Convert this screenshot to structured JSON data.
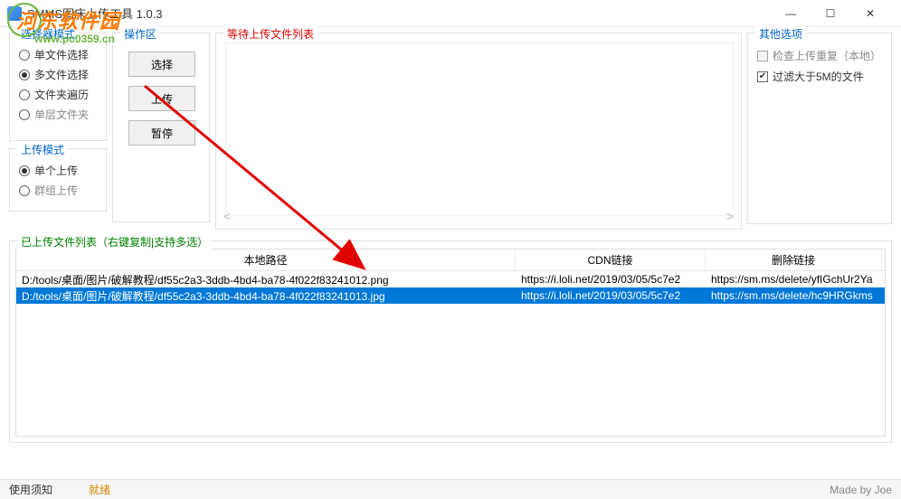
{
  "window": {
    "title": "SMMS图床上传工具 1.0.3"
  },
  "watermark": {
    "text": "河东软件园",
    "url": "www.pc0359.cn"
  },
  "selectMode": {
    "title": "选择器模式",
    "options": [
      {
        "label": "单文件选择",
        "checked": false,
        "enabled": true
      },
      {
        "label": "多文件选择",
        "checked": true,
        "enabled": true
      },
      {
        "label": "文件夹遍历",
        "checked": false,
        "enabled": true
      },
      {
        "label": "单层文件夹",
        "checked": false,
        "enabled": false
      }
    ]
  },
  "uploadMode": {
    "title": "上传模式",
    "options": [
      {
        "label": "单个上传",
        "checked": true,
        "enabled": true
      },
      {
        "label": "群组上传",
        "checked": false,
        "enabled": false
      }
    ]
  },
  "actions": {
    "title": "操作区",
    "select": "选择",
    "upload": "上传",
    "pause": "暂停"
  },
  "pendingList": {
    "title": "等待上传文件列表"
  },
  "otherOptions": {
    "title": "其他选项",
    "checkDuplicate": {
      "label": "检查上传重复（本地）",
      "checked": false,
      "enabled": false
    },
    "filterLarge": {
      "label": "过滤大于5M的文件",
      "checked": true,
      "enabled": true
    }
  },
  "uploadedList": {
    "title": "已上传文件列表（右键复制|支持多选）",
    "columns": {
      "path": "本地路径",
      "cdn": "CDN链接",
      "del": "删除链接"
    },
    "rows": [
      {
        "path": "D:/tools/桌面/图片/破解教程/df55c2a3-3ddb-4bd4-ba78-4f022f83241012.png",
        "cdn": "https://i.loli.net/2019/03/05/5c7e2",
        "del": "https://sm.ms/delete/yfIGchUr2Ya",
        "selected": false
      },
      {
        "path": "D:/tools/桌面/图片/破解教程/df55c2a3-3ddb-4bd4-ba78-4f022f83241013.jpg",
        "cdn": "https://i.loli.net/2019/03/05/5c7e2",
        "del": "https://sm.ms/delete/hc9HRGkms",
        "selected": true
      }
    ]
  },
  "statusbar": {
    "help": "使用须知",
    "ready": "就绪",
    "author": "Made by Joe"
  }
}
